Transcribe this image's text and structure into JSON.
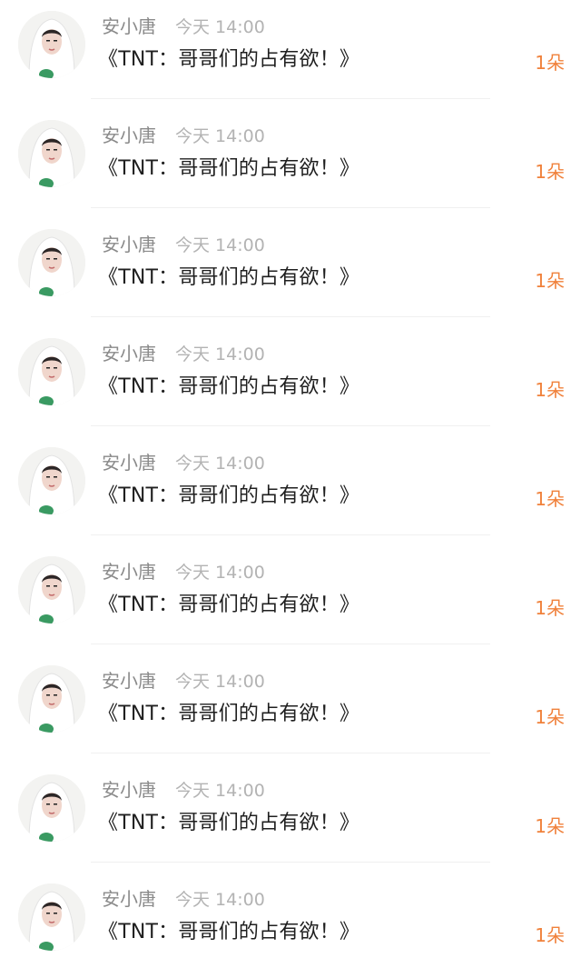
{
  "colors": {
    "name": "#8a8a8a",
    "time": "#b3b3b3",
    "title": "#1f1f1f",
    "count": "#f0813b",
    "divider": "#f0f0f0"
  },
  "items": [
    {
      "avatar_icon": "user-avatar-photo",
      "name": "安小唐",
      "time": "今天 14:00",
      "title": "《TNT：哥哥们的占有欲！》",
      "count": "1朵"
    },
    {
      "avatar_icon": "user-avatar-photo",
      "name": "安小唐",
      "time": "今天 14:00",
      "title": "《TNT：哥哥们的占有欲！》",
      "count": "1朵"
    },
    {
      "avatar_icon": "user-avatar-photo",
      "name": "安小唐",
      "time": "今天 14:00",
      "title": "《TNT：哥哥们的占有欲！》",
      "count": "1朵"
    },
    {
      "avatar_icon": "user-avatar-photo",
      "name": "安小唐",
      "time": "今天 14:00",
      "title": "《TNT：哥哥们的占有欲！》",
      "count": "1朵"
    },
    {
      "avatar_icon": "user-avatar-photo",
      "name": "安小唐",
      "time": "今天 14:00",
      "title": "《TNT：哥哥们的占有欲！》",
      "count": "1朵"
    },
    {
      "avatar_icon": "user-avatar-photo",
      "name": "安小唐",
      "time": "今天 14:00",
      "title": "《TNT：哥哥们的占有欲！》",
      "count": "1朵"
    },
    {
      "avatar_icon": "user-avatar-photo",
      "name": "安小唐",
      "time": "今天 14:00",
      "title": "《TNT：哥哥们的占有欲！》",
      "count": "1朵"
    },
    {
      "avatar_icon": "user-avatar-photo",
      "name": "安小唐",
      "time": "今天 14:00",
      "title": "《TNT：哥哥们的占有欲！》",
      "count": "1朵"
    },
    {
      "avatar_icon": "user-avatar-photo",
      "name": "安小唐",
      "time": "今天 14:00",
      "title": "《TNT：哥哥们的占有欲！》",
      "count": "1朵"
    }
  ]
}
